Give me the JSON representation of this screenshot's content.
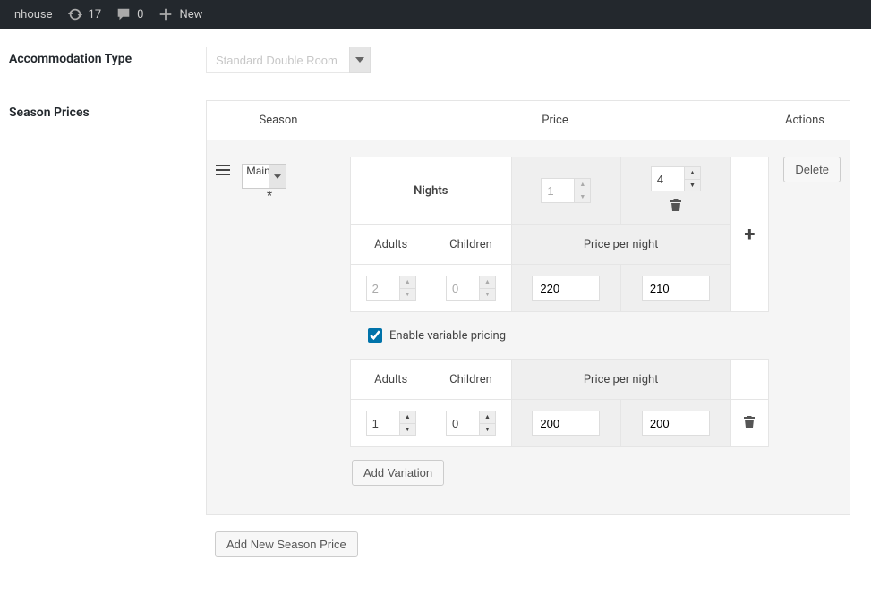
{
  "adminbar": {
    "site_name": "nhouse",
    "updates_count": "17",
    "comments_count": "0",
    "new_label": "New"
  },
  "labels": {
    "accommodation_type": "Accommodation Type",
    "season_prices": "Season Prices",
    "season_col": "Season",
    "price_col": "Price",
    "actions_col": "Actions",
    "nights": "Nights",
    "adults": "Adults",
    "children": "Children",
    "price_per_night": "Price per night",
    "enable_variable": "Enable variable pricing",
    "add_variation": "Add Variation",
    "add_season_price": "Add New Season Price",
    "delete": "Delete",
    "asterisk": "*"
  },
  "accommodation_type": {
    "selected": "Standard Double Room"
  },
  "season": {
    "selected": "Main S"
  },
  "base": {
    "nights": [
      {
        "value": "1",
        "disabled": true,
        "deletable": false
      },
      {
        "value": "4",
        "disabled": false,
        "deletable": true
      }
    ],
    "adults": "2",
    "adults_disabled": true,
    "children": "0",
    "children_disabled": true,
    "prices": [
      "220",
      "210"
    ]
  },
  "enable_variable_pricing": true,
  "variations": [
    {
      "adults": "1",
      "children": "0",
      "prices": [
        "200",
        "200"
      ]
    }
  ]
}
